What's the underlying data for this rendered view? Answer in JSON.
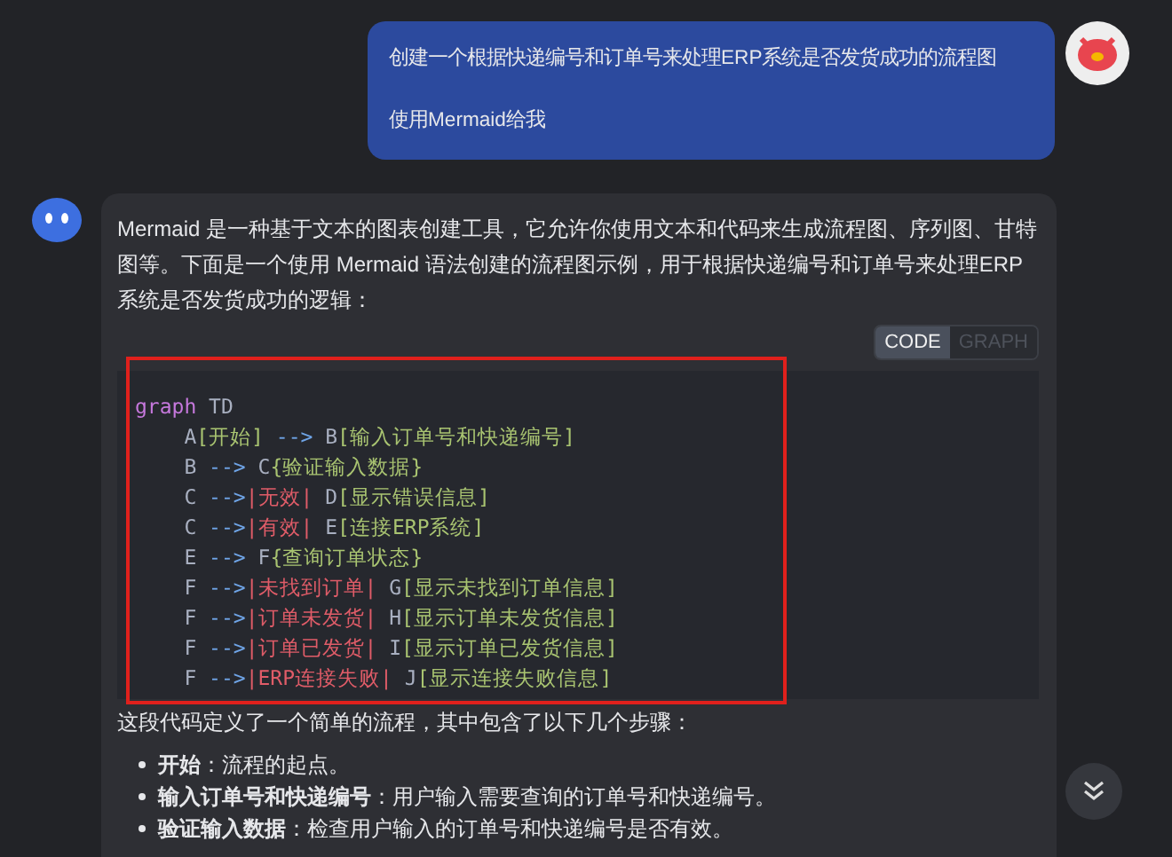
{
  "messages": [
    {
      "kind": "user",
      "paragraphs": [
        "创建一个根据快递编号和订单号来处理ERP系统是否发货成功的流程图",
        "使用Mermaid给我"
      ]
    },
    {
      "kind": "assistant",
      "intro": "Mermaid 是一种基于文本的图表创建工具，它允许你使用文本和代码来生成流程图、序列图、甘特图等。下面是一个使用 Mermaid 语法创建的流程图示例，用于根据快递编号和订单号来处理ERP系统是否发货成功的逻辑：",
      "view_toggle": [
        {
          "label": "CODE",
          "selected": true
        },
        {
          "label": "GRAPH",
          "selected": false
        }
      ],
      "code_lines": [
        [
          {
            "kind": "keyword",
            "text": "graph"
          },
          {
            "kind": "plain",
            "text": " TD"
          }
        ],
        [
          {
            "kind": "plain",
            "text": "    A"
          },
          {
            "kind": "node",
            "text": "[开始]"
          },
          {
            "kind": "arrow",
            "text": " -->"
          },
          {
            "kind": "plain",
            "text": " B"
          },
          {
            "kind": "node",
            "text": "[输入订单号和快递编号]"
          }
        ],
        [
          {
            "kind": "plain",
            "text": "    B "
          },
          {
            "kind": "arrow",
            "text": "-->"
          },
          {
            "kind": "plain",
            "text": " C"
          },
          {
            "kind": "node",
            "text": "{验证输入数据}"
          }
        ],
        [
          {
            "kind": "plain",
            "text": "    C "
          },
          {
            "kind": "arrow",
            "text": "-->"
          },
          {
            "kind": "label",
            "text": "|无效|"
          },
          {
            "kind": "plain",
            "text": " D"
          },
          {
            "kind": "node",
            "text": "[显示错误信息]"
          }
        ],
        [
          {
            "kind": "plain",
            "text": "    C "
          },
          {
            "kind": "arrow",
            "text": "-->"
          },
          {
            "kind": "label",
            "text": "|有效|"
          },
          {
            "kind": "plain",
            "text": " E"
          },
          {
            "kind": "node",
            "text": "[连接ERP系统]"
          }
        ],
        [
          {
            "kind": "plain",
            "text": "    E "
          },
          {
            "kind": "arrow",
            "text": "-->"
          },
          {
            "kind": "plain",
            "text": " F"
          },
          {
            "kind": "node",
            "text": "{查询订单状态}"
          }
        ],
        [
          {
            "kind": "plain",
            "text": "    F "
          },
          {
            "kind": "arrow",
            "text": "-->"
          },
          {
            "kind": "label",
            "text": "|未找到订单|"
          },
          {
            "kind": "plain",
            "text": " G"
          },
          {
            "kind": "node",
            "text": "[显示未找到订单信息]"
          }
        ],
        [
          {
            "kind": "plain",
            "text": "    F "
          },
          {
            "kind": "arrow",
            "text": "-->"
          },
          {
            "kind": "label",
            "text": "|订单未发货|"
          },
          {
            "kind": "plain",
            "text": " H"
          },
          {
            "kind": "node",
            "text": "[显示订单未发货信息]"
          }
        ],
        [
          {
            "kind": "plain",
            "text": "    F "
          },
          {
            "kind": "arrow",
            "text": "-->"
          },
          {
            "kind": "label",
            "text": "|订单已发货|"
          },
          {
            "kind": "plain",
            "text": " I"
          },
          {
            "kind": "node",
            "text": "[显示订单已发货信息]"
          }
        ],
        [
          {
            "kind": "plain",
            "text": "    F "
          },
          {
            "kind": "arrow",
            "text": "-->"
          },
          {
            "kind": "label",
            "text": "|ERP连接失败|"
          },
          {
            "kind": "plain",
            "text": " J"
          },
          {
            "kind": "node",
            "text": "[显示连接失败信息]"
          }
        ]
      ],
      "summary": "这段代码定义了一个简单的流程，其中包含了以下几个步骤：",
      "steps": [
        "**开始**：流程的起点。",
        "**输入订单号和快递编号**：用户输入需要查询的订单号和快递编号。",
        "**验证输入数据**：检查用户输入的订单号和快递编号是否有效。"
      ]
    }
  ]
}
